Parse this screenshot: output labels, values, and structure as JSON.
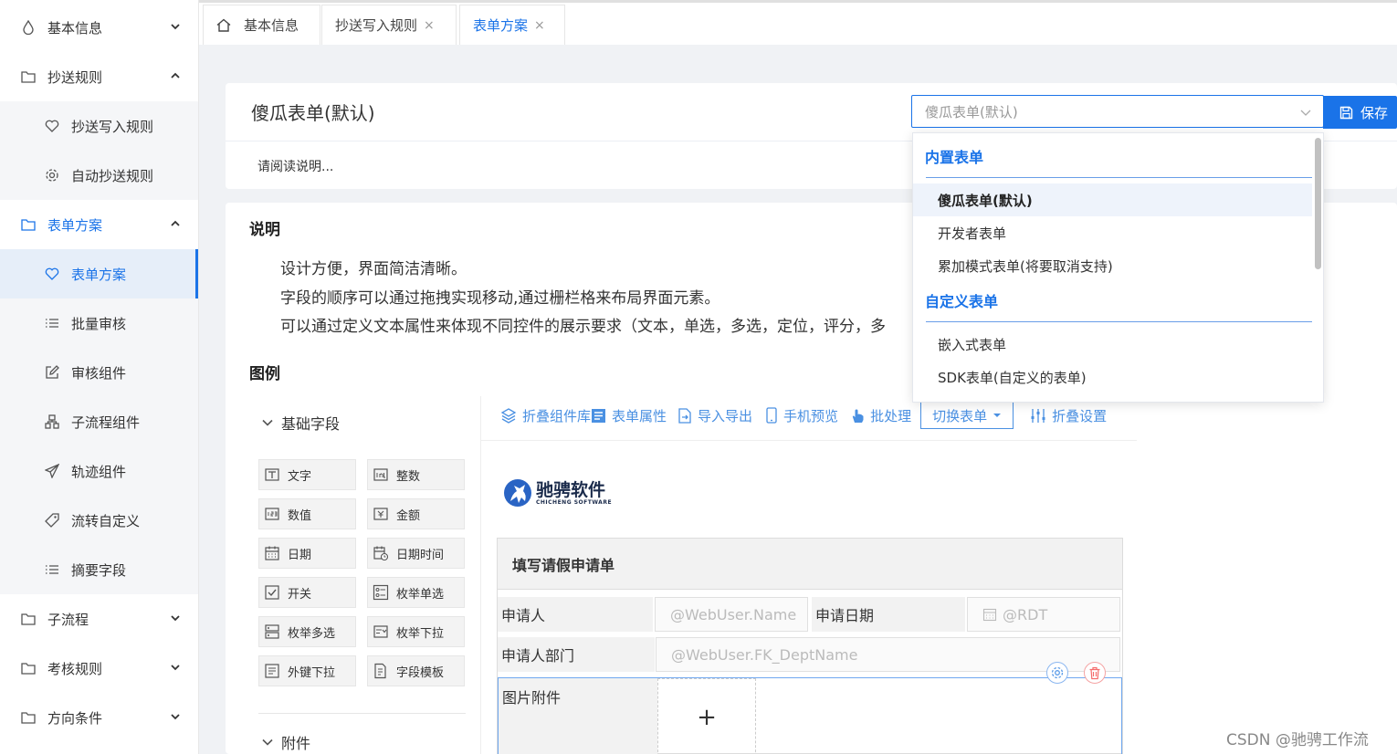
{
  "sidebar": {
    "items": [
      {
        "label": "基本信息",
        "icon": "drop-icon",
        "expanded": false
      },
      {
        "label": "抄送规则",
        "icon": "folder-icon",
        "expanded": true
      },
      {
        "label": "抄送写入规则",
        "icon": "heart-icon"
      },
      {
        "label": "自动抄送规则",
        "icon": "gear-icon"
      },
      {
        "label": "表单方案",
        "icon": "folder-icon",
        "expanded": true
      },
      {
        "label": "表单方案",
        "icon": "heart-icon",
        "active": true
      },
      {
        "label": "批量审核",
        "icon": "list-icon"
      },
      {
        "label": "审核组件",
        "icon": "edit-icon"
      },
      {
        "label": "子流程组件",
        "icon": "hierarchy-icon"
      },
      {
        "label": "轨迹组件",
        "icon": "send-icon"
      },
      {
        "label": "流转自定义",
        "icon": "tag-icon"
      },
      {
        "label": "摘要字段",
        "icon": "list-icon"
      },
      {
        "label": "子流程",
        "icon": "folder-icon",
        "expanded": false
      },
      {
        "label": "考核规则",
        "icon": "folder-icon",
        "expanded": false
      },
      {
        "label": "方向条件",
        "icon": "folder-icon",
        "expanded": false
      }
    ]
  },
  "tabs": [
    {
      "label": "基本信息",
      "closable": false
    },
    {
      "label": "抄送写入规则",
      "closable": true,
      "close_glyph": "×"
    },
    {
      "label": "表单方案",
      "closable": true,
      "close_glyph": "×",
      "active": true
    }
  ],
  "header": {
    "title": "傻瓜表单(默认)",
    "hint": "请阅读说明...",
    "select_value": "傻瓜表单(默认)",
    "save_label": "保存"
  },
  "dropdown": {
    "groups": [
      {
        "label": "内置表单",
        "options": [
          "傻瓜表单(默认)",
          "开发者表单",
          "累加模式表单(将要取消支持)"
        ]
      },
      {
        "label": "自定义表单",
        "options": [
          "嵌入式表单",
          "SDK表单(自定义的表单)"
        ]
      }
    ],
    "selected": "傻瓜表单(默认)"
  },
  "content": {
    "desc_heading": "说明",
    "bullets": [
      "设计方便，界面简洁清晰。",
      "字段的顺序可以通过拖拽实现移动,通过栅栏格来布局界面元素。",
      "可以通过定义文本属性来体现不同控件的展示要求（文本，单选，多选，定位，评分，多"
    ],
    "example_heading": "图例"
  },
  "palette": {
    "basic_heading": "基础字段",
    "attach_heading": "附件",
    "components": [
      "文字",
      "整数",
      "数值",
      "金额",
      "日期",
      "日期时间",
      "开关",
      "枚举单选",
      "枚举多选",
      "枚举下拉",
      "外键下拉",
      "字段模板"
    ]
  },
  "toolbar": {
    "items": [
      "折叠组件库",
      "表单属性",
      "导入导出",
      "手机预览",
      "批处理"
    ],
    "switch_label": "切换表单",
    "fold_label": "折叠设置"
  },
  "logo": {
    "cn": "驰骋软件",
    "en": "CHICHENG SOFTWARE"
  },
  "form": {
    "title": "填写请假申请单",
    "applicant_label": "申请人",
    "applicant_value": "@WebUser.Name",
    "date_label": "申请日期",
    "date_value": "@RDT",
    "dept_label": "申请人部门",
    "dept_value": "@WebUser.FK_DeptName",
    "attach_label": "图片附件",
    "add_glyph": "+"
  },
  "watermark": "CSDN @驰骋工作流",
  "colors": {
    "accent": "#1a73e8",
    "danger": "#f56c6c"
  }
}
